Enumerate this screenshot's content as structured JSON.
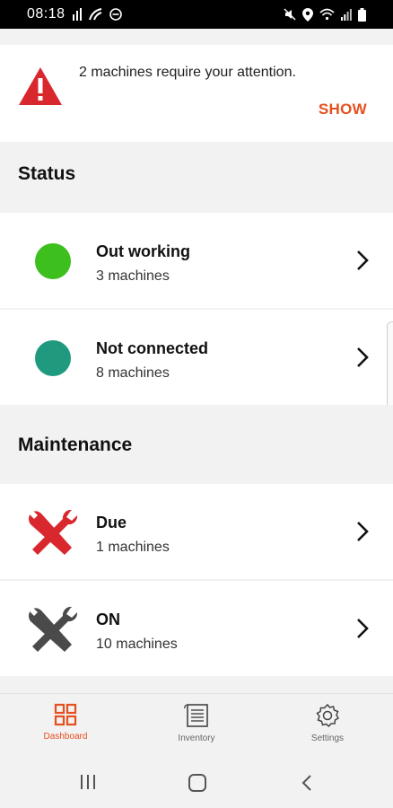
{
  "status_bar": {
    "time": "08:18",
    "left_icons": [
      "signal-bars-icon",
      "data-icon",
      "dnd-icon"
    ],
    "right_icons": [
      "mute-icon",
      "location-icon",
      "wifi-icon",
      "cell-signal-icon",
      "battery-icon"
    ]
  },
  "alert": {
    "icon": "warning-icon",
    "message": "2 machines require your attention.",
    "action_label": "SHOW",
    "accent_color": "#e5501f",
    "icon_color": "#d9272e"
  },
  "status_section": {
    "header": "Status",
    "items": [
      {
        "title": "Out working",
        "subtitle": "3 machines",
        "color": "#3dbf1d"
      },
      {
        "title": "Not connected",
        "subtitle": "8 machines",
        "color": "#1f9a7f"
      }
    ]
  },
  "maintenance_section": {
    "header": "Maintenance",
    "items": [
      {
        "title": "Due",
        "subtitle": "1 machines",
        "icon": "wrench-red-icon",
        "color": "#d9272e"
      },
      {
        "title": "ON",
        "subtitle": "10 machines",
        "icon": "wrench-gray-icon",
        "color": "#4a4a4a"
      }
    ]
  },
  "bottom_nav": {
    "items": [
      {
        "label": "Dashboard",
        "icon": "dashboard-icon",
        "active": true
      },
      {
        "label": "Inventory",
        "icon": "inventory-icon",
        "active": false
      },
      {
        "label": "Settings",
        "icon": "settings-icon",
        "active": false
      }
    ]
  },
  "system_nav": {
    "icons": [
      "recents-icon",
      "home-icon",
      "back-icon"
    ]
  }
}
